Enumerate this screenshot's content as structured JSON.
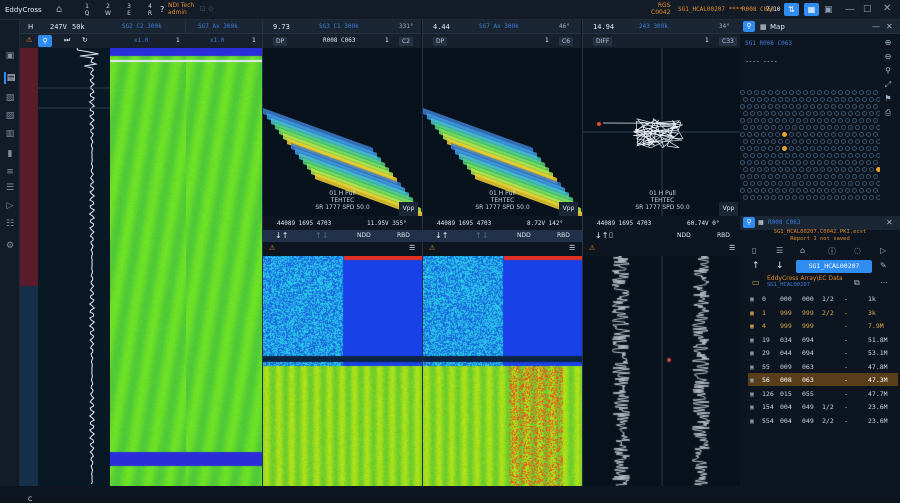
{
  "app": {
    "name": "EddyCross",
    "project": "NDI Tech",
    "user": "admin"
  },
  "topbar": {
    "toolbtns": [
      {
        "n": "1",
        "s": "Q"
      },
      {
        "n": "2",
        "s": "W"
      },
      {
        "n": "3",
        "s": "E"
      },
      {
        "n": "4",
        "s": "R"
      }
    ],
    "help": "?",
    "title_top": "RGS",
    "title_sub": "C0042",
    "file": "SG1_HCAL00207 ****",
    "tube": "R008 C063",
    "page": "7/10"
  },
  "col1": {
    "h": "H",
    "v": "247V",
    "f": "50k"
  },
  "strip2": {
    "title": "SG2 C2 300k",
    "zoom": "x1.0",
    "n": "1"
  },
  "strip3": {
    "title": "SG7 Ax 300k",
    "zoom": "x1.0",
    "n": "1"
  },
  "lis1": {
    "val": "9.73",
    "title": "SG3 C1 300k",
    "deg": "331°",
    "mode": "DP",
    "tube": "R008 C063",
    "n": "1",
    "ch": "C2",
    "probe": "01 H Pull",
    "company": "TEHTEC",
    "sr": "SR 1777 SPD 50.0",
    "btn": "Vpp",
    "coords": "44089 1695 4703",
    "meas": "11.95V 355°",
    "ndd": "NDD",
    "rbd": "RBD"
  },
  "lis2": {
    "val": "4.44",
    "title": "SG7 Ax 300k",
    "deg": "46°",
    "mode": "DP",
    "n": "1",
    "ch": "C6",
    "probe": "01 H Pull",
    "company": "TEHTEC",
    "sr": "SR 1777 SPD 50.0",
    "btn": "Vpp",
    "coords": "44089 1695 4703",
    "meas": "8.72V 142°",
    "ndd": "NDD",
    "rbd": "RBD"
  },
  "lis3": {
    "val": "14.94",
    "title": "243 300k",
    "deg": "34°",
    "mode": "DIFF",
    "n": "1",
    "ch": "C33",
    "probe": "01 H Pull",
    "company": "TEHTEC",
    "sr": "SR 1777 SPD 50.0",
    "btn": "Vpp",
    "coords": "44089 1695 4703",
    "meas": "60.74V 0°",
    "ndd": "NDD",
    "rbd": "RBD"
  },
  "map": {
    "title": "Map",
    "header": "SG1 R008 C063",
    "dashes": "---- ----",
    "footer": "R008 C063"
  },
  "file": {
    "name": "SG1_HCAL00207.C0042.PKI.ecst",
    "status": "Report 1 not saved",
    "tube_btn": "SG1_HCAL00207",
    "path": "EddyCross Array\\EC Data",
    "sub": "SG1_HCAL00207"
  },
  "table": [
    {
      "id": "0",
      "a": "000",
      "b": "000",
      "c": "1/2",
      "d": "-",
      "e": "1k",
      "col": "#c7d4e1"
    },
    {
      "id": "1",
      "a": "999",
      "b": "999",
      "c": "2/2",
      "d": "-",
      "e": "3k",
      "col": "#d7a548"
    },
    {
      "id": "4",
      "a": "999",
      "b": "999",
      "c": "",
      "d": "-",
      "e": "7.9M",
      "col": "#d7a548"
    },
    {
      "id": "19",
      "a": "034",
      "b": "094",
      "c": "",
      "d": "-",
      "e": "51.8M",
      "col": "#c7d4e1"
    },
    {
      "id": "29",
      "a": "044",
      "b": "094",
      "c": "",
      "d": "-",
      "e": "53.1M",
      "col": "#c7d4e1"
    },
    {
      "id": "55",
      "a": "009",
      "b": "063",
      "c": "",
      "d": "-",
      "e": "47.8M",
      "col": "#c7d4e1"
    },
    {
      "id": "56",
      "a": "008",
      "b": "063",
      "c": "",
      "d": "-",
      "e": "47.3M",
      "col": "#ffffff"
    },
    {
      "id": "126",
      "a": "015",
      "b": "055",
      "c": "",
      "d": "-",
      "e": "47.7M",
      "col": "#c7d4e1"
    },
    {
      "id": "154",
      "a": "004",
      "b": "049",
      "c": "1/2",
      "d": "-",
      "e": "23.6M",
      "col": "#c7d4e1"
    },
    {
      "id": "554",
      "a": "004",
      "b": "049",
      "c": "2/2",
      "d": "-",
      "e": "23.6M",
      "col": "#c7d4e1"
    }
  ],
  "bottom": {
    "c": "C"
  }
}
